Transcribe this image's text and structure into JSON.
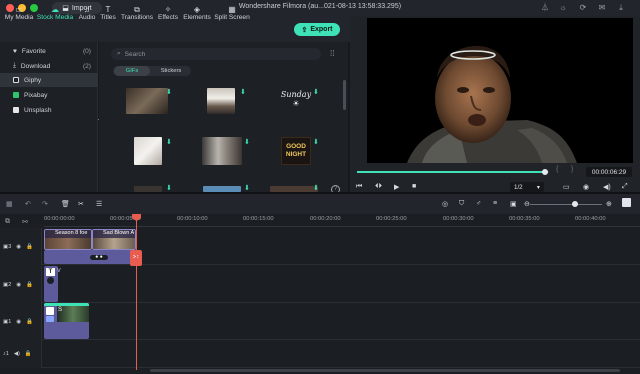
{
  "window": {
    "title": "Wondershare Filmora (au...021-08-13 13:58:33.295)",
    "import_label": "Import"
  },
  "toolbar": {
    "tabs": [
      {
        "label": "My Media",
        "icon": "folder-icon"
      },
      {
        "label": "Stock Media",
        "icon": "cloud-icon"
      },
      {
        "label": "Audio",
        "icon": "music-note-icon"
      },
      {
        "label": "Titles",
        "icon": "text-icon"
      },
      {
        "label": "Transitions",
        "icon": "transition-icon"
      },
      {
        "label": "Effects",
        "icon": "effects-icon"
      },
      {
        "label": "Elements",
        "icon": "elements-icon"
      },
      {
        "label": "Split Screen",
        "icon": "split-screen-icon"
      }
    ],
    "export_label": "Export"
  },
  "sidebar": {
    "items": [
      {
        "label": "Favorite",
        "count": "(0)"
      },
      {
        "label": "Download",
        "count": "(2)"
      },
      {
        "label": "Giphy",
        "count": ""
      },
      {
        "label": "Pixabay",
        "count": ""
      },
      {
        "label": "Unsplash",
        "count": ""
      }
    ]
  },
  "media": {
    "search_placeholder": "Search",
    "tabs": [
      "GIFs",
      "Stickers"
    ],
    "active_tab": "GIFs",
    "stickers": {
      "sunday": "Sunday",
      "good_night": "GOOD NIGHT"
    }
  },
  "preview": {
    "timecode": "00:00:06:29",
    "quality": "1/2",
    "progress": 0.98
  },
  "timeline": {
    "ruler": [
      "00:00:00:00",
      "00:00:05:00",
      "00:00:10:00",
      "00:00:15:00",
      "00:00:20:00",
      "00:00:25:00",
      "00:00:30:00",
      "00:00:35:00",
      "00:00:40:00"
    ],
    "tracks": [
      {
        "label": "3"
      },
      {
        "label": "2"
      },
      {
        "label": "1"
      },
      {
        "label": "1"
      }
    ],
    "clips": {
      "clip_a": "Season 8 foe",
      "clip_b": "Sad Blown A",
      "title_clip": "T",
      "video_clip": "S"
    }
  },
  "colors": {
    "accent": "#3ee2b6",
    "playhead": "#e85d4f",
    "clip": "#5e5b9d"
  }
}
